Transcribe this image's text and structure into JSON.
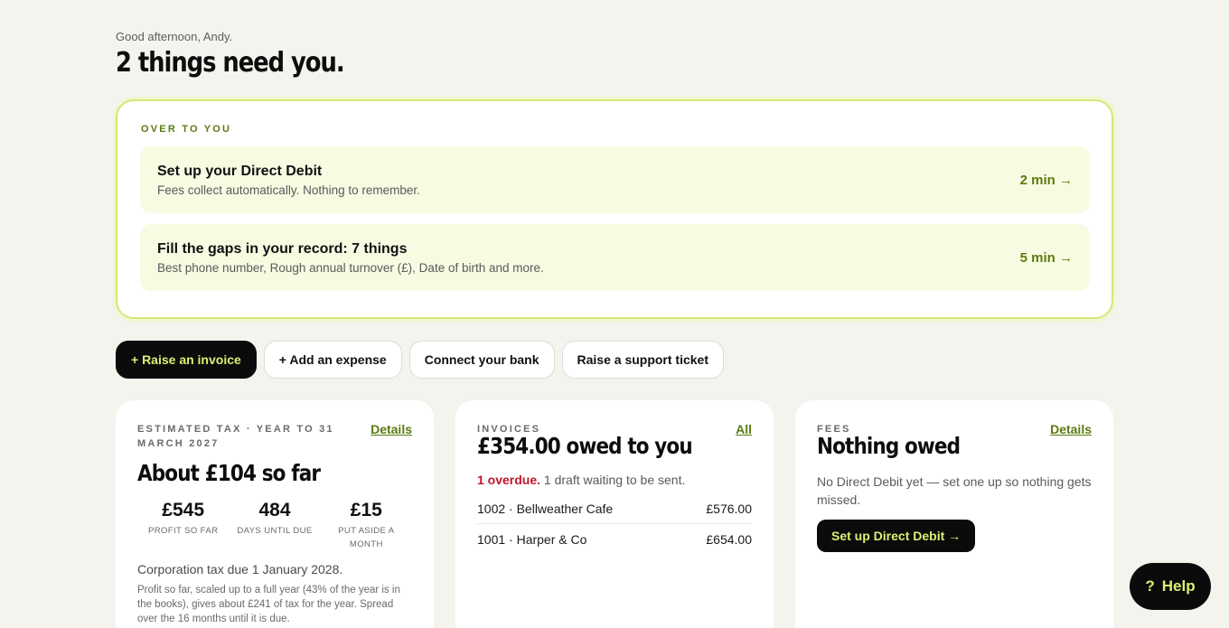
{
  "header": {
    "greeting": "Good afternoon, Andy.",
    "title": "2 things need you."
  },
  "todo": {
    "label": "OVER TO YOU",
    "tasks": [
      {
        "title": "Set up your Direct Debit",
        "subtitle": "Fees collect automatically. Nothing to remember.",
        "time": "2 min →"
      },
      {
        "title": "Fill the gaps in your record: 7 things",
        "subtitle": "Best phone number, Rough annual turnover (£), Date of birth and more.",
        "time": "5 min →"
      }
    ]
  },
  "actions": {
    "raise_invoice": "+ Raise an invoice",
    "add_expense": "+ Add an expense",
    "connect_bank": "Connect your bank",
    "support_ticket": "Raise a support ticket"
  },
  "tax": {
    "eyebrow": "ESTIMATED TAX · YEAR TO 31 MARCH 2027",
    "link": "Details",
    "headline": "About £104 so far",
    "stats": [
      {
        "value": "£545",
        "label": "PROFIT SO FAR"
      },
      {
        "value": "484",
        "label": "DAYS UNTIL DUE"
      },
      {
        "value": "£15",
        "label": "PUT ASIDE A MONTH"
      }
    ],
    "due_note": "Corporation tax due 1 January 2028.",
    "explanation": "Profit so far, scaled up to a full year (43% of the year is in the books), gives about £241 of tax for the year. Spread over the 16 months until it is due."
  },
  "invoices": {
    "eyebrow": "INVOICES",
    "link": "All",
    "headline": "£354.00 owed to you",
    "overdue": "1 overdue.",
    "draft_note": "1 draft waiting to be sent.",
    "rows": [
      {
        "ref": "1002 · Bellweather Cafe",
        "amount": "£576.00"
      },
      {
        "ref": "1001 · Harper & Co",
        "amount": "£654.00"
      }
    ]
  },
  "fees": {
    "eyebrow": "FEES",
    "link": "Details",
    "headline": "Nothing owed",
    "text": "No Direct Debit yet — set one up so nothing gets missed.",
    "button": "Set up Direct Debit →"
  },
  "help": {
    "icon": "?",
    "label": "Help"
  },
  "colors": {
    "accent": "#dbef73",
    "accent_dark": "#5a7a10",
    "overdue": "#c0152a",
    "background": "#f4f3ee"
  }
}
